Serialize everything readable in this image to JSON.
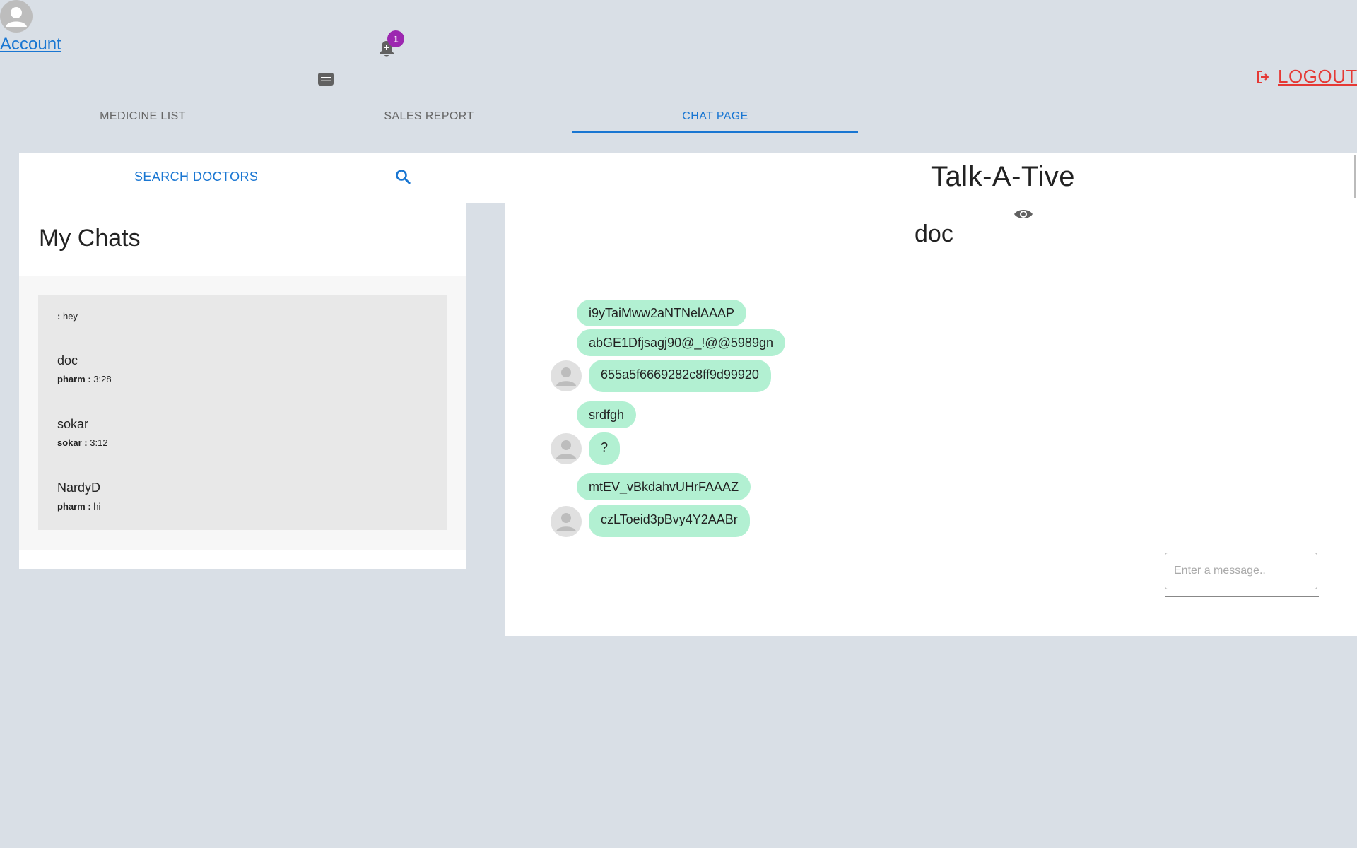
{
  "header": {
    "account_label": "Account",
    "notification_count": "1",
    "logout_label": "LOGOUT"
  },
  "tabs": [
    {
      "label": "MEDICINE LIST",
      "active": false
    },
    {
      "label": "SALES REPORT",
      "active": false
    },
    {
      "label": "CHAT PAGE",
      "active": true
    }
  ],
  "sidebar": {
    "search_label": "SEARCH DOCTORS",
    "title": "My Chats",
    "chats": [
      {
        "name": "",
        "sender": ":",
        "message": "hey"
      },
      {
        "name": "doc",
        "sender": "pharm :",
        "message": "3:28"
      },
      {
        "name": "sokar",
        "sender": "sokar :",
        "message": "3:12"
      },
      {
        "name": "NardyD",
        "sender": "pharm :",
        "message": "hi"
      }
    ]
  },
  "chat": {
    "app_title": "Talk-A-Tive",
    "current_user": "doc",
    "messages": [
      {
        "text": "i9yTaiMww2aNTNelAAAP",
        "avatar": false
      },
      {
        "text": "abGE1Dfjsagj90@_!@@5989gn",
        "avatar": false
      },
      {
        "text": "655a5f6669282c8ff9d99920",
        "avatar": true
      },
      {
        "text": "srdfgh",
        "avatar": false
      },
      {
        "text": "?",
        "avatar": true
      },
      {
        "text": "mtEV_vBkdahvUHrFAAAZ",
        "avatar": false
      },
      {
        "text": "czLToeid3pBvy4Y2AABr",
        "avatar": true
      }
    ],
    "input_placeholder": "Enter a message.."
  },
  "colors": {
    "background": "#d9dfe6",
    "accent": "#1976d2",
    "logout": "#e53935",
    "badge": "#9c27b0",
    "bubble": "#b2f0d2"
  },
  "icons": [
    "person-icon",
    "bell-plus-icon",
    "message-icon",
    "logout-icon",
    "search-icon",
    "eye-icon"
  ]
}
